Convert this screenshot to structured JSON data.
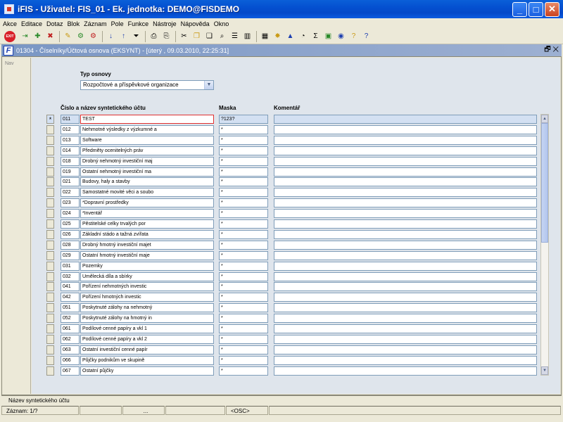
{
  "app": {
    "title": "iFIS - Uživatel: FIS_01 - Ek. jednotka: DEMO@FISDEMO"
  },
  "menu": [
    "Akce",
    "Editace",
    "Dotaz",
    "Blok",
    "Záznam",
    "Pole",
    "Funkce",
    "Nástroje",
    "Nápověda",
    "Okno"
  ],
  "toolbar": {
    "exit_label": "EXIT"
  },
  "form": {
    "title": "01304 - Číselníky/Účtová osnova (EKSYNT) - [úterý , 09.03.2010, 22:25:31]",
    "nav_label": "Nav"
  },
  "fields": {
    "typ_osnovy_label": "Typ osnovy",
    "typ_osnovy_value": "Rozpočtové a příspěvkové organizace",
    "col_account": "Číslo a název syntetického účtu",
    "col_mask": "Maska",
    "col_comment": "Komentář"
  },
  "rows": [
    {
      "code": "011",
      "name": "TEST",
      "mask": "?123?",
      "marker": "*"
    },
    {
      "code": "012",
      "name": "Nehmotné výsledky z výzkumné a",
      "mask": "*"
    },
    {
      "code": "013",
      "name": "Software",
      "mask": "*"
    },
    {
      "code": "014",
      "name": "Předměty ocenitelných práv",
      "mask": "*"
    },
    {
      "code": "018",
      "name": "Drobný nehmotný investiční maj",
      "mask": "*"
    },
    {
      "code": "019",
      "name": "Ostatní nehmotný investiční ma",
      "mask": "*"
    },
    {
      "code": "021",
      "name": "Budovy, haly a stavby",
      "mask": "*"
    },
    {
      "code": "022",
      "name": "Samostatné movité věci a soubo",
      "mask": "*"
    },
    {
      "code": "023",
      "name": "*Dopravní prostředky",
      "mask": "*"
    },
    {
      "code": "024",
      "name": "*Inventář",
      "mask": "*"
    },
    {
      "code": "025",
      "name": "Pěstitelské celky trvalých por",
      "mask": "*"
    },
    {
      "code": "026",
      "name": "Základní stádo a tažná zvířata",
      "mask": "*"
    },
    {
      "code": "028",
      "name": "Drobný hmotný investiční majet",
      "mask": "*"
    },
    {
      "code": "029",
      "name": "Ostatní hmotný investiční maje",
      "mask": "*"
    },
    {
      "code": "031",
      "name": "Pozemky",
      "mask": "*"
    },
    {
      "code": "032",
      "name": "Umělecká díla a sbírky",
      "mask": "*"
    },
    {
      "code": "041",
      "name": "Pořízení nehmotných investic",
      "mask": "*"
    },
    {
      "code": "042",
      "name": "Pořízení hmotných investic",
      "mask": "*"
    },
    {
      "code": "051",
      "name": "Poskytnuté zálohy na nehmotný",
      "mask": "*"
    },
    {
      "code": "052",
      "name": "Poskytnuté zálohy na hmotný in",
      "mask": "*"
    },
    {
      "code": "061",
      "name": "Podílové cenné papíry a vkl 1",
      "mask": "*"
    },
    {
      "code": "062",
      "name": "Podílové cenné papíry a vkl 2",
      "mask": "*"
    },
    {
      "code": "063",
      "name": "Ostatní investiční cenné papír",
      "mask": "*"
    },
    {
      "code": "066",
      "name": "Půjčky podnikům ve skupině",
      "mask": "*"
    },
    {
      "code": "067",
      "name": "Ostatní půjčky",
      "mask": "*"
    }
  ],
  "hint": "Název syntetického účtu",
  "status": {
    "record": "Záznam: 1/?",
    "dots": "...",
    "osc": "<OSC>"
  }
}
